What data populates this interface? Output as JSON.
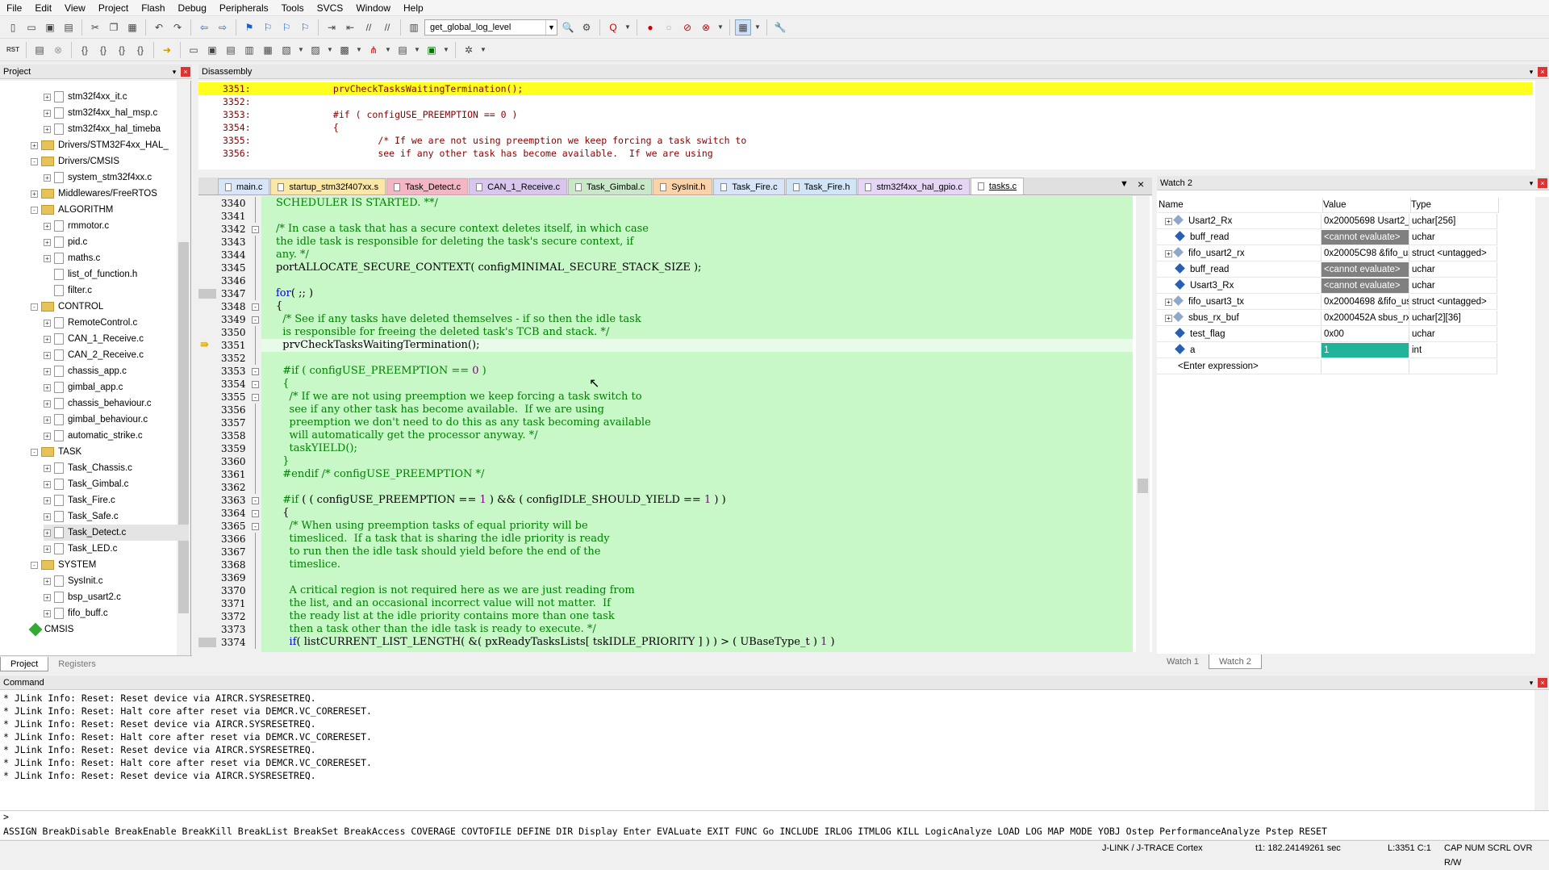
{
  "menu": [
    "File",
    "Edit",
    "View",
    "Project",
    "Flash",
    "Debug",
    "Peripherals",
    "Tools",
    "SVCS",
    "Window",
    "Help"
  ],
  "toolbar": {
    "function_combo": "get_global_log_level"
  },
  "project_panel": {
    "title": "Project",
    "items": [
      {
        "label": "stm32f4xx_it.c",
        "kind": "file",
        "level": 3
      },
      {
        "label": "stm32f4xx_hal_msp.c",
        "kind": "file",
        "level": 3
      },
      {
        "label": "stm32f4xx_hal_timeba",
        "kind": "file",
        "level": 3
      },
      {
        "label": "Drivers/STM32F4xx_HAL_",
        "kind": "folder",
        "level": 2,
        "expand": "+"
      },
      {
        "label": "Drivers/CMSIS",
        "kind": "folder",
        "level": 2,
        "expand": "-"
      },
      {
        "label": "system_stm32f4xx.c",
        "kind": "file",
        "level": 3
      },
      {
        "label": "Middlewares/FreeRTOS",
        "kind": "folder",
        "level": 2,
        "expand": "+"
      },
      {
        "label": "ALGORITHM",
        "kind": "folder",
        "level": 2,
        "expand": "-"
      },
      {
        "label": "rmmotor.c",
        "kind": "file",
        "level": 3
      },
      {
        "label": "pid.c",
        "kind": "file",
        "level": 3
      },
      {
        "label": "maths.c",
        "kind": "file",
        "level": 3
      },
      {
        "label": "list_of_function.h",
        "kind": "file",
        "level": 3,
        "noexpand": true
      },
      {
        "label": "filter.c",
        "kind": "file",
        "level": 3,
        "noexpand": true
      },
      {
        "label": "CONTROL",
        "kind": "folder",
        "level": 2,
        "expand": "-"
      },
      {
        "label": "RemoteControl.c",
        "kind": "file",
        "level": 3
      },
      {
        "label": "CAN_1_Receive.c",
        "kind": "file",
        "level": 3
      },
      {
        "label": "CAN_2_Receive.c",
        "kind": "file",
        "level": 3
      },
      {
        "label": "chassis_app.c",
        "kind": "file",
        "level": 3
      },
      {
        "label": "gimbal_app.c",
        "kind": "file",
        "level": 3
      },
      {
        "label": "chassis_behaviour.c",
        "kind": "file",
        "level": 3
      },
      {
        "label": "gimbal_behaviour.c",
        "kind": "file",
        "level": 3
      },
      {
        "label": "automatic_strike.c",
        "kind": "file",
        "level": 3
      },
      {
        "label": "TASK",
        "kind": "folder",
        "level": 2,
        "expand": "-"
      },
      {
        "label": "Task_Chassis.c",
        "kind": "file",
        "level": 3
      },
      {
        "label": "Task_Gimbal.c",
        "kind": "file",
        "level": 3
      },
      {
        "label": "Task_Fire.c",
        "kind": "file",
        "level": 3
      },
      {
        "label": "Task_Safe.c",
        "kind": "file",
        "level": 3
      },
      {
        "label": "Task_Detect.c",
        "kind": "file",
        "level": 3,
        "selected": true
      },
      {
        "label": "Task_LED.c",
        "kind": "file",
        "level": 3
      },
      {
        "label": "SYSTEM",
        "kind": "folder",
        "level": 2,
        "expand": "-"
      },
      {
        "label": "SysInit.c",
        "kind": "file",
        "level": 3
      },
      {
        "label": "bsp_usart2.c",
        "kind": "file",
        "level": 3
      },
      {
        "label": "fifo_buff.c",
        "kind": "file",
        "level": 3
      },
      {
        "label": "CMSIS",
        "kind": "diamond",
        "level": 2
      }
    ],
    "tabs": [
      "Project",
      "Registers"
    ]
  },
  "disassembly": {
    "title": "Disassembly",
    "lines": [
      {
        "ln": "3351:",
        "code": "              prvCheckTasksWaitingTermination();",
        "hl": true
      },
      {
        "ln": "3352:",
        "code": ""
      },
      {
        "ln": "3353:",
        "code": "              #if ( configUSE_PREEMPTION == 0 )"
      },
      {
        "ln": "3354:",
        "code": "              {"
      },
      {
        "ln": "3355:",
        "code": "                      /* If we are not using preemption we keep forcing a task switch to"
      },
      {
        "ln": "3356:",
        "code": "                      see if any other task has become available.  If we are using"
      }
    ]
  },
  "editor": {
    "tabs": [
      {
        "label": "main.c",
        "color": "#d8e4f8"
      },
      {
        "label": "startup_stm32f407xx.s",
        "color": "#fbe7a6"
      },
      {
        "label": "Task_Detect.c",
        "color": "#f4b6c2"
      },
      {
        "label": "CAN_1_Receive.c",
        "color": "#d8c6ef"
      },
      {
        "label": "Task_Gimbal.c",
        "color": "#c8e8c8"
      },
      {
        "label": "SysInit.h",
        "color": "#fbd3a8"
      },
      {
        "label": "Task_Fire.c",
        "color": "#d8e4f8"
      },
      {
        "label": "Task_Fire.h",
        "color": "#d0e6f6"
      },
      {
        "label": "stm32f4xx_hal_gpio.c",
        "color": "#e4d6f4"
      },
      {
        "label": "tasks.c",
        "color": "#f0f0f0",
        "active": true
      }
    ],
    "lines": [
      {
        "ln": "3340",
        "html": "<span class='com'>SCHEDULER IS STARTED. **/</span>"
      },
      {
        "ln": "3341",
        "html": ""
      },
      {
        "ln": "3342",
        "fold": "-",
        "html": "<span class='com'>/* In case a task that has a secure context deletes itself, in which case</span>"
      },
      {
        "ln": "3343",
        "html": "<span class='com'>the idle task is responsible for deleting the task's secure context, if</span>"
      },
      {
        "ln": "3344",
        "html": "<span class='com'>any. */</span>"
      },
      {
        "ln": "3345",
        "html": "portALLOCATE_SECURE_CONTEXT( configMINIMAL_SECURE_STACK_SIZE );"
      },
      {
        "ln": "3346",
        "html": ""
      },
      {
        "ln": "3347",
        "mark": true,
        "html": "<span class='kw'>for</span>( ;; )"
      },
      {
        "ln": "3348",
        "fold": "-",
        "html": "{"
      },
      {
        "ln": "3349",
        "fold": "-",
        "html": "  <span class='com'>/* See if any tasks have deleted themselves - if so then the idle task</span>"
      },
      {
        "ln": "3350",
        "html": "  <span class='com'>is responsible for freeing the deleted task's TCB and stack. */</span>"
      },
      {
        "ln": "3351",
        "cur": true,
        "html": "  prvCheckTasksWaitingTermination();"
      },
      {
        "ln": "3352",
        "html": ""
      },
      {
        "ln": "3353",
        "fold": "-",
        "html": "  <span class='com'>#if ( configUSE_PREEMPTION == <span class='num'>0</span> )</span>"
      },
      {
        "ln": "3354",
        "fold": "-",
        "html": "  <span class='com'>{</span>"
      },
      {
        "ln": "3355",
        "fold": "-",
        "html": "    <span class='com'>/* If we are not using preemption we keep forcing a task switch to</span>"
      },
      {
        "ln": "3356",
        "html": "    <span class='com'>see if any other task has become available.  If we are using</span>"
      },
      {
        "ln": "3357",
        "html": "    <span class='com'>preemption we don't need to do this as any task becoming available</span>"
      },
      {
        "ln": "3358",
        "html": "    <span class='com'>will automatically get the processor anyway. */</span>"
      },
      {
        "ln": "3359",
        "html": "    <span class='com'>taskYIELD();</span>"
      },
      {
        "ln": "3360",
        "html": "  <span class='com'>}</span>"
      },
      {
        "ln": "3361",
        "html": "  <span class='com'>#endif /* configUSE_PREEMPTION */</span>"
      },
      {
        "ln": "3362",
        "html": ""
      },
      {
        "ln": "3363",
        "fold": "-",
        "html": "  <span class='com'>#if</span> ( ( configUSE_PREEMPTION == <span class='num'>1</span> ) &amp;&amp; ( configIDLE_SHOULD_YIELD == <span class='num'>1</span> ) )"
      },
      {
        "ln": "3364",
        "fold": "-",
        "html": "  {"
      },
      {
        "ln": "3365",
        "fold": "-",
        "html": "    <span class='com'>/* When using preemption tasks of equal priority will be</span>"
      },
      {
        "ln": "3366",
        "html": "    <span class='com'>timesliced.  If a task that is sharing the idle priority is ready</span>"
      },
      {
        "ln": "3367",
        "html": "    <span class='com'>to run then the idle task should yield before the end of the</span>"
      },
      {
        "ln": "3368",
        "html": "    <span class='com'>timeslice.</span>"
      },
      {
        "ln": "3369",
        "html": ""
      },
      {
        "ln": "3370",
        "html": "    <span class='com'>A critical region is not required here as we are just reading from</span>"
      },
      {
        "ln": "3371",
        "html": "    <span class='com'>the list, and an occasional incorrect value will not matter.  If</span>"
      },
      {
        "ln": "3372",
        "html": "    <span class='com'>the ready list at the idle priority contains more than one task</span>"
      },
      {
        "ln": "3373",
        "html": "    <span class='com'>then a task other than the idle task is ready to execute. */</span>"
      },
      {
        "ln": "3374",
        "mark": true,
        "html": "    <span class='kw'>if</span>( listCURRENT_LIST_LENGTH( &amp;( pxReadyTasksLists[ tskIDLE_PRIORITY ] ) ) &gt; ( UBaseType_t ) <span class='num'>1</span> )"
      }
    ]
  },
  "watch": {
    "title": "Watch 2",
    "headers": [
      "Name",
      "Value",
      "Type"
    ],
    "rows": [
      {
        "name": "Usart2_Rx",
        "value": "0x20005698 Usart2_Rx[...",
        "type": "uchar[256]",
        "expand": "+",
        "icon": "struct"
      },
      {
        "name": "buff_read",
        "value": "<cannot evaluate>",
        "type": "uchar",
        "icon": "var",
        "bad": true
      },
      {
        "name": "fifo_usart2_rx",
        "value": "0x20005C98 &fifo_usa...",
        "type": "struct <untagged>",
        "expand": "+",
        "icon": "struct"
      },
      {
        "name": "buff_read",
        "value": "<cannot evaluate>",
        "type": "uchar",
        "icon": "var",
        "bad": true
      },
      {
        "name": "Usart3_Rx",
        "value": "<cannot evaluate>",
        "type": "uchar",
        "icon": "var",
        "bad": true
      },
      {
        "name": "fifo_usart3_tx",
        "value": "0x20004698 &fifo_usar...",
        "type": "struct <untagged>",
        "expand": "+",
        "icon": "struct"
      },
      {
        "name": "sbus_rx_buf",
        "value": "0x2000452A sbus_rx_buf",
        "type": "uchar[2][36]",
        "expand": "+",
        "icon": "struct"
      },
      {
        "name": "test_flag",
        "value": "0x00",
        "type": "uchar",
        "icon": "var"
      },
      {
        "name": "a",
        "value": "1",
        "type": "int",
        "icon": "var",
        "sel": true
      }
    ],
    "enter": "<Enter expression>",
    "tabs": [
      "Watch 1",
      "Watch 2"
    ]
  },
  "command": {
    "title": "Command",
    "lines": [
      "* JLink Info: Reset: Reset device via AIRCR.SYSRESETREQ.",
      "* JLink Info: Reset: Halt core after reset via DEMCR.VC_CORERESET.",
      "* JLink Info: Reset: Reset device via AIRCR.SYSRESETREQ.",
      "* JLink Info: Reset: Halt core after reset via DEMCR.VC_CORERESET.",
      "* JLink Info: Reset: Reset device via AIRCR.SYSRESETREQ.",
      "* JLink Info: Reset: Halt core after reset via DEMCR.VC_CORERESET.",
      "* JLink Info: Reset: Reset device via AIRCR.SYSRESETREQ."
    ],
    "prompt": ">",
    "help": "ASSIGN BreakDisable BreakEnable BreakKill BreakList BreakSet BreakAccess COVERAGE COVTOFILE DEFINE DIR Display Enter EVALuate EXIT FUNC Go INCLUDE IRLOG ITMLOG KILL LogicAnalyze LOAD LOG MAP MODE YOBJ Ostep PerformanceAnalyze Pstep RESET"
  },
  "status": {
    "debugger": "J-LINK / J-TRACE Cortex",
    "time": "t1: 182.24149261 sec",
    "pos": "L:3351 C:1",
    "flags": "CAP  NUM  SCRL  OVR  R/W"
  }
}
